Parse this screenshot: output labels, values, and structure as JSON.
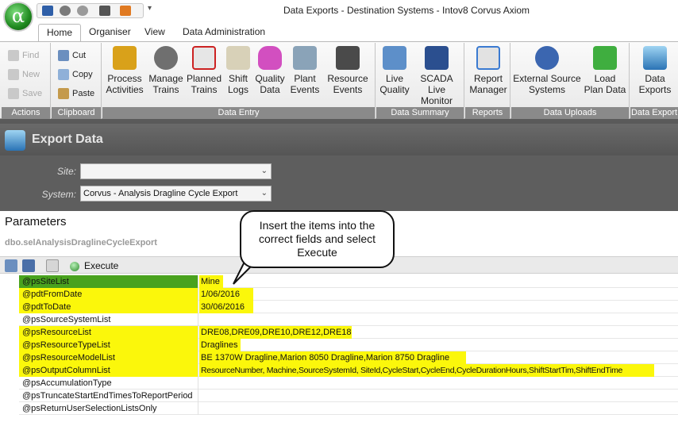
{
  "window": {
    "title": "Data Exports - Destination Systems - Intov8 Corvus Axiom",
    "orb_symbol": "α"
  },
  "tabs": [
    "Home",
    "Organiser",
    "View",
    "Data Administration"
  ],
  "ribbon": {
    "actions": {
      "label": "Actions",
      "find": "Find",
      "new": "New",
      "save": "Save"
    },
    "clipboard": {
      "label": "Clipboard",
      "cut": "Cut",
      "copy": "Copy",
      "paste": "Paste"
    },
    "data_entry": {
      "label": "Data Entry",
      "process_activities": [
        "Process",
        "Activities"
      ],
      "manage_trains": [
        "Manage",
        "Trains"
      ],
      "planned_trains": [
        "Planned",
        "Trains"
      ],
      "shift_logs": [
        "Shift",
        "Logs"
      ],
      "quality_data": [
        "Quality",
        "Data"
      ],
      "plant_events": [
        "Plant",
        "Events"
      ],
      "resource_events": [
        "Resource",
        "Events"
      ]
    },
    "data_summary": {
      "label": "Data Summary",
      "live_quality": [
        "Live",
        "Quality"
      ],
      "scada": [
        "SCADA",
        "Live Monitor"
      ]
    },
    "reports": {
      "label": "Reports",
      "report_manager": [
        "Report",
        "Manager"
      ]
    },
    "data_uploads": {
      "label": "Data Uploads",
      "external_source": [
        "External Source",
        "Systems"
      ],
      "load_plan": [
        "Load",
        "Plan Data"
      ]
    },
    "data_export": {
      "label": "Data Export",
      "data_exports": [
        "Data",
        "Exports"
      ]
    }
  },
  "export": {
    "title": "Export Data",
    "site_label": "Site:",
    "site_value": "",
    "system_label": "System:",
    "system_value": "Corvus - Analysis Dragline Cycle Export"
  },
  "parameters": {
    "title": "Parameters",
    "proc_name": "dbo.selAnalysisDraglineCycleExport",
    "execute_label": "Execute",
    "rows": [
      {
        "name": "@psSiteList",
        "value": "Mine"
      },
      {
        "name": "@pdtFromDate",
        "value": "1/06/2016"
      },
      {
        "name": "@pdtToDate",
        "value": "30/06/2016"
      },
      {
        "name": "@psSourceSystemList",
        "value": ""
      },
      {
        "name": "@psResourceList",
        "value": "DRE08,DRE09,DRE10,DRE12,DRE18"
      },
      {
        "name": "@psResourceTypeList",
        "value": "Draglines"
      },
      {
        "name": "@psResourceModelList",
        "value": "BE 1370W Dragline,Marion 8050 Dragline,Marion 8750 Dragline"
      },
      {
        "name": "@psOutputColumnList",
        "value": "ResourceNumber, Machine,SourceSystemId, SiteId,CycleStart,CycleEnd,CycleDurationHours,ShiftStartTim,ShiftEndTime"
      },
      {
        "name": "@psAccumulationType",
        "value": ""
      },
      {
        "name": "@psTruncateStartEndTimesToReportPeriod",
        "value": ""
      },
      {
        "name": "@psReturnUserSelectionListsOnly",
        "value": ""
      }
    ]
  },
  "callout": {
    "text": "Insert the items into the correct fields and select Execute"
  },
  "colors": {
    "highlight": "#fbf70b",
    "selected": "#49a21e",
    "group_label_bg": "#8a8a8a"
  }
}
